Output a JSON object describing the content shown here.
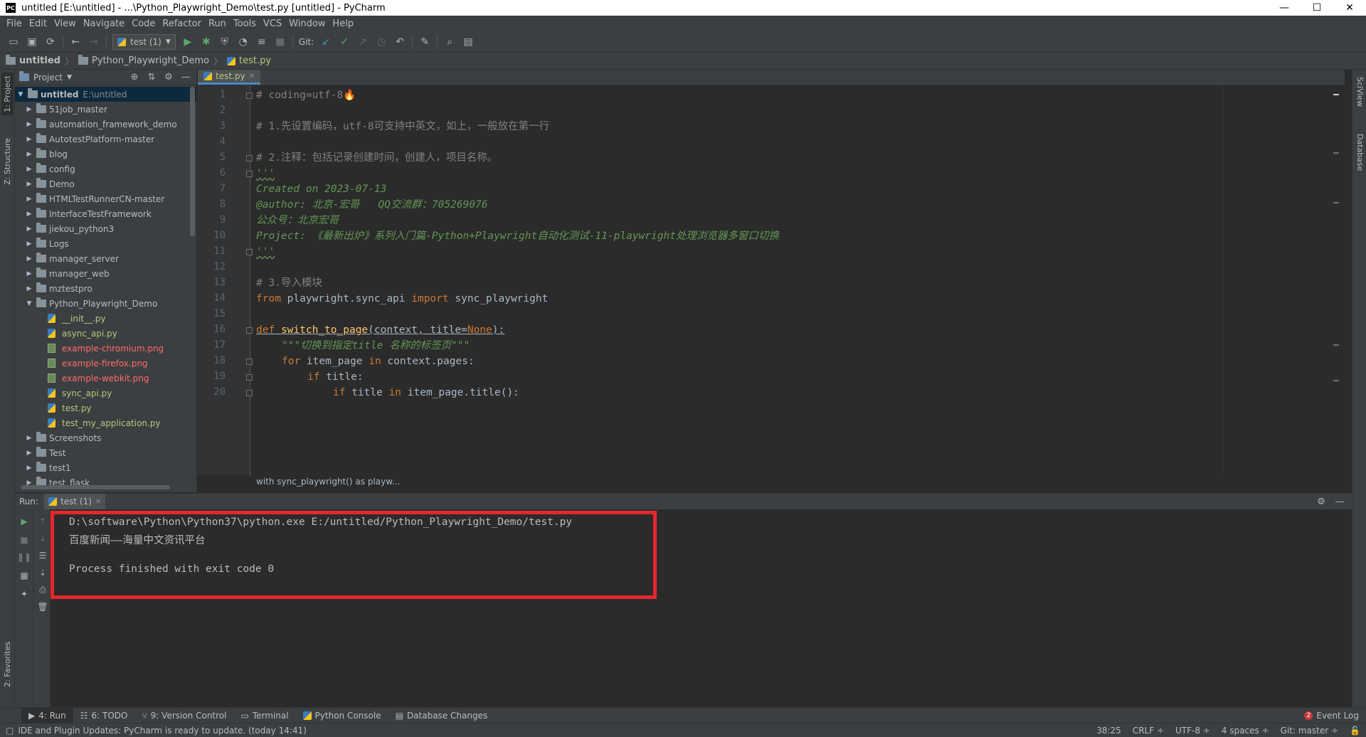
{
  "window": {
    "title": "untitled [E:\\untitled] - ...\\Python_Playwright_Demo\\test.py [untitled] - PyCharm",
    "app_icon": "PC",
    "controls": [
      "—",
      "☐",
      "✕"
    ]
  },
  "menu": [
    "File",
    "Edit",
    "View",
    "Navigate",
    "Code",
    "Refactor",
    "Run",
    "Tools",
    "VCS",
    "Window",
    "Help"
  ],
  "toolbar": {
    "run_config": "test (1)",
    "git_label": "Git:"
  },
  "navbar": {
    "crumbs": [
      "untitled",
      "Python_Playwright_Demo",
      "test.py"
    ]
  },
  "left_stripe": {
    "project_tab": "1: Project",
    "structure_tab": "Z: Structure",
    "favorites_tab": "2: Favorites"
  },
  "right_stripe": {
    "sciview_tab": "SciView",
    "database_tab": "Database"
  },
  "project": {
    "header": "Project",
    "root": {
      "name": "untitled",
      "path": "E:\\untitled"
    },
    "items": [
      {
        "label": "51job_master",
        "type": "folder"
      },
      {
        "label": "automation_framework_demo",
        "type": "folder"
      },
      {
        "label": "AutotestPlatform-master",
        "type": "folder"
      },
      {
        "label": "blog",
        "type": "folder"
      },
      {
        "label": "config",
        "type": "folder"
      },
      {
        "label": "Demo",
        "type": "folder"
      },
      {
        "label": "HTMLTestRunnerCN-master",
        "type": "folder"
      },
      {
        "label": "InterfaceTestFramework",
        "type": "folder"
      },
      {
        "label": "jiekou_python3",
        "type": "folder"
      },
      {
        "label": "Logs",
        "type": "folder"
      },
      {
        "label": "manager_server",
        "type": "folder"
      },
      {
        "label": "manager_web",
        "type": "folder"
      },
      {
        "label": "mztestpro",
        "type": "folder"
      },
      {
        "label": "Python_Playwright_Demo",
        "type": "folder-open"
      },
      {
        "label": "__init__.py",
        "type": "py"
      },
      {
        "label": "async_api.py",
        "type": "py"
      },
      {
        "label": "example-chromium.png",
        "type": "png"
      },
      {
        "label": "example-firefox.png",
        "type": "png"
      },
      {
        "label": "example-webkit.png",
        "type": "png"
      },
      {
        "label": "sync_api.py",
        "type": "py"
      },
      {
        "label": "test.py",
        "type": "py"
      },
      {
        "label": "test_my_application.py",
        "type": "py"
      },
      {
        "label": "Screenshots",
        "type": "folder"
      },
      {
        "label": "Test",
        "type": "folder"
      },
      {
        "label": "test1",
        "type": "folder"
      },
      {
        "label": "test_flask",
        "type": "folder"
      }
    ]
  },
  "editor": {
    "tab": "test.py",
    "line_numbers": [
      "1",
      "2",
      "3",
      "4",
      "5",
      "6",
      "7",
      "8",
      "9",
      "10",
      "11",
      "12",
      "13",
      "14",
      "15",
      "16",
      "17",
      "18",
      "19",
      "20"
    ],
    "lines": {
      "l1": "# coding=utf-8🔥",
      "l3": "# 1.先设置编码，utf-8可支持中英文，如上，一般放在第一行",
      "l5": "# 2.注释：包括记录创建时间，创建人，项目名称。",
      "l6": "'''",
      "l7": "Created on 2023-07-13",
      "l8": "@author: 北京-宏哥   QQ交流群：705269076",
      "l9": "公众号：北京宏哥",
      "l10": "Project: 《最新出炉》系列入门篇-Python+Playwright自动化测试-11-playwright处理浏览器多窗口切换",
      "l11": "'''",
      "l13": "# 3.导入模块",
      "l14_from": "from",
      "l14_mod": " playwright.sync_api ",
      "l14_import": "import",
      "l14_name": " sync_playwright",
      "l16_def": "def",
      "l16_fn": "switch_to_page",
      "l16_args_a": "(context, title=",
      "l16_none": "None",
      "l16_args_b": "):",
      "l17": "\"\"\"切换到指定title 名称的标签页\"\"\"",
      "l18_for": "for",
      "l18_mid": " item_page ",
      "l18_in": "in",
      "l18_end": " context.pages:",
      "l19_if": "if",
      "l19_end": " title:",
      "l20_if": "if",
      "l20_mid": " title ",
      "l20_in": "in",
      "l20_end": " item_page.title():"
    },
    "bottom_breadcrumb": "with sync_playwright() as playw..."
  },
  "run": {
    "label": "Run:",
    "tab": "test (1)",
    "console": [
      "D:\\software\\Python\\Python37\\python.exe E:/untitled/Python_Playwright_Demo/test.py",
      "百度新闻——海量中文资讯平台",
      "",
      "Process finished with exit code 0"
    ],
    "highlight_color": "#e8262d"
  },
  "toolwindows": [
    {
      "label": "4: Run",
      "icon": "run-icon"
    },
    {
      "label": "6: TODO",
      "icon": "todo-icon"
    },
    {
      "label": "9: Version Control",
      "icon": "vcs-icon"
    },
    {
      "label": "Terminal",
      "icon": "terminal-icon"
    },
    {
      "label": "Python Console",
      "icon": "python-console-icon"
    },
    {
      "label": "Database Changes",
      "icon": "database-changes-icon"
    }
  ],
  "event_log": {
    "count": "2",
    "label": "Event Log"
  },
  "status": {
    "message": "IDE and Plugin Updates: PyCharm is ready to update. (today 14:41)",
    "position": "38:25",
    "line_sep": "CRLF ÷",
    "encoding": "UTF-8 ÷",
    "indent": "4 spaces ÷",
    "git_branch": "Git: master ÷"
  }
}
